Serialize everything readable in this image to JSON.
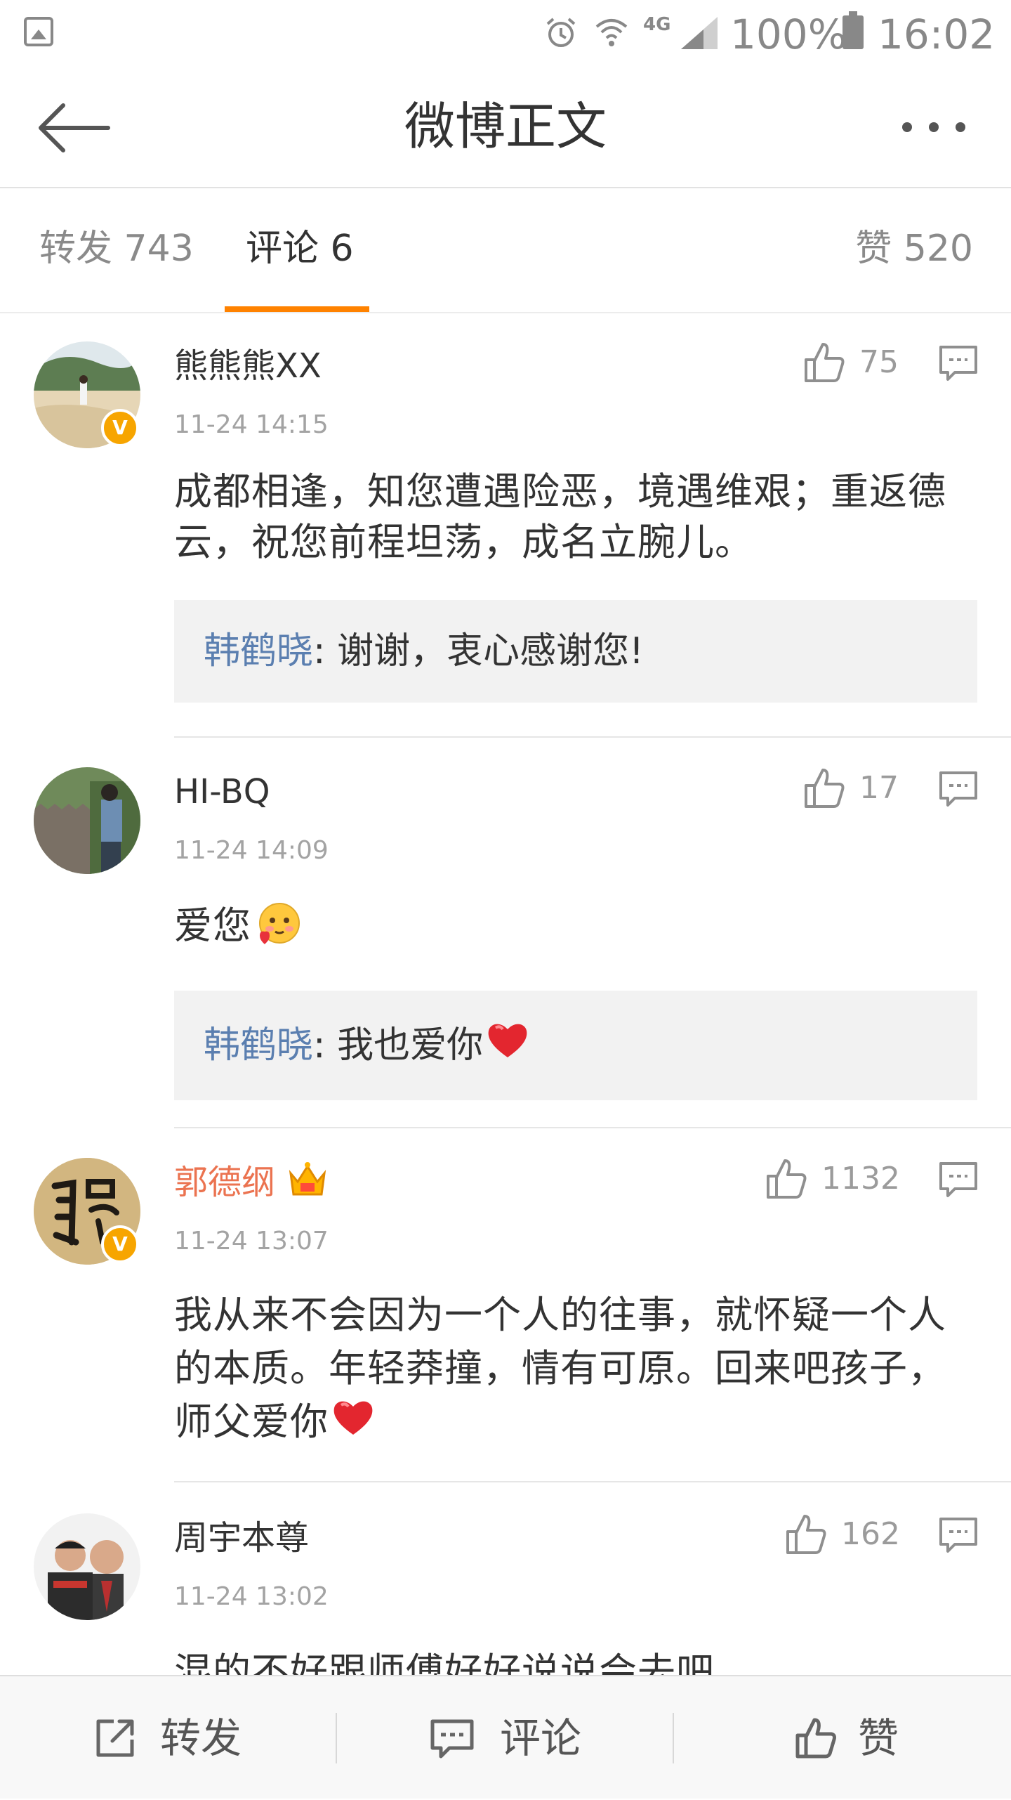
{
  "status_bar": {
    "network": "4G",
    "battery": "100%",
    "time": "16:02",
    "icons": [
      "gallery-icon",
      "alarm-icon",
      "wifi-icon",
      "signal-icon",
      "battery-icon"
    ]
  },
  "header": {
    "title": "微博正文"
  },
  "tabs": {
    "repost": "转发 743",
    "comments": "评论 6",
    "likes": "赞 520",
    "accent_color": "#ff8200"
  },
  "comments": [
    {
      "user": "熊熊熊XX",
      "verified": true,
      "time": "11-24 14:15",
      "likes": "75",
      "text": "成都相逢，知您遭遇险恶，境遇维艰；重返德云，祝您前程坦荡，成名立腕儿。",
      "reply": {
        "author": "韩鹤晓",
        "text": ": 谢谢，衷心感谢您!"
      }
    },
    {
      "user": "HI-BQ",
      "verified": false,
      "time": "11-24 14:09",
      "likes": "17",
      "text": "爱您",
      "reply": {
        "author": "韩鹤晓",
        "text": ": 我也爱你"
      }
    },
    {
      "user": "郭德纲",
      "verified": true,
      "time": "11-24 13:07",
      "likes": "1132",
      "text_line1": "我从来不会因为一个人的往事，就怀疑一个人",
      "text_line2": "的本质。年轻莽撞，情有可原。回来吧孩子，",
      "text_line3": "师父爱你"
    },
    {
      "user": "周宇本尊",
      "verified": false,
      "time": "11-24 13:02",
      "likes": "162",
      "text": "混的不好跟师傅好好说说会去吧。"
    }
  ],
  "toolbar": {
    "repost_label": "转发",
    "comment_label": "评论",
    "like_label": "赞"
  },
  "colors": {
    "accent": "#ff8200",
    "vip_name": "#eb7350",
    "reply_author": "#5b7fb0",
    "verified_badge": "#f7a500"
  }
}
